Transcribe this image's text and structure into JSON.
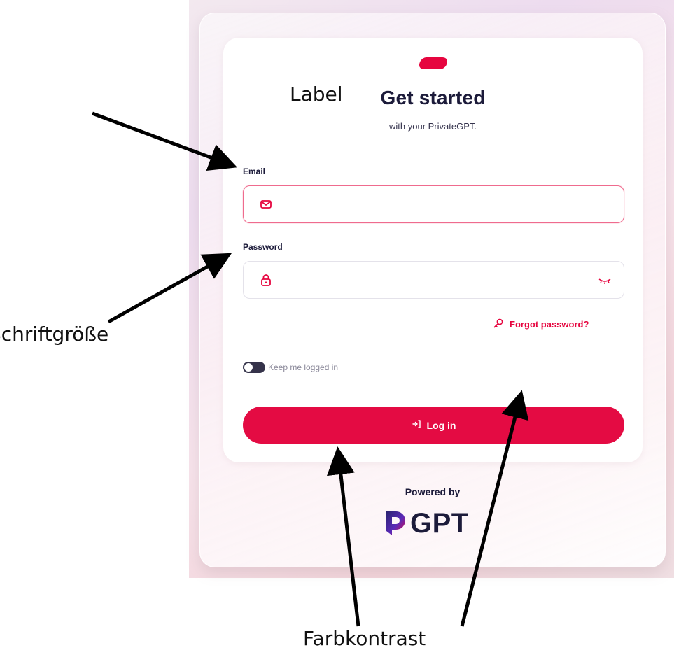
{
  "login": {
    "title": "Get started",
    "subtitle": "with your PrivateGPT.",
    "email_label": "Email",
    "email_value": "",
    "password_label": "Password",
    "password_value": "",
    "forgot_label": "Forgot password?",
    "keep_logged_label": "Keep me logged in",
    "keep_logged_on": true,
    "login_label": "Log in"
  },
  "footer": {
    "powered_label": "Powered by",
    "brand_text": "GPT"
  },
  "annotations": {
    "label": "Label",
    "font_size": "Schriftgröße",
    "contrast": "Farbkontrast"
  },
  "colors": {
    "accent": "#e40b43",
    "text": "#1c1b3a",
    "brand_purple": "#3b2a8f"
  },
  "icons": {
    "email": "mail-icon",
    "password": "lock-icon",
    "visibility": "eye-closed-icon",
    "forgot": "key-icon",
    "login": "login-arrow-icon"
  }
}
